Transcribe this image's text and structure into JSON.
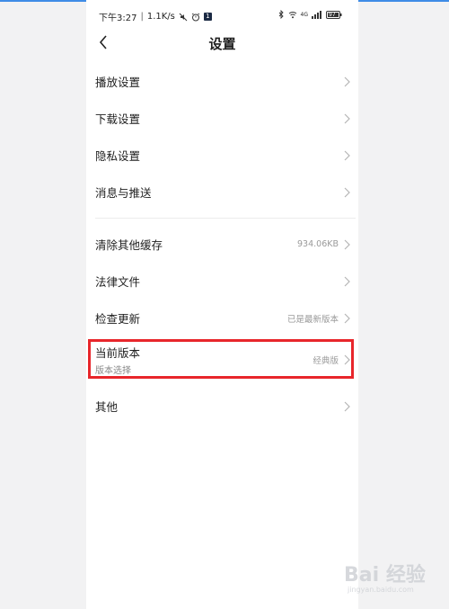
{
  "status_bar": {
    "time": "下午3:27",
    "speed": "1.1K/s",
    "network": "4G",
    "battery": "97"
  },
  "nav": {
    "title": "设置"
  },
  "group1": [
    {
      "label": "播放设置"
    },
    {
      "label": "下载设置"
    },
    {
      "label": "隐私设置"
    },
    {
      "label": "消息与推送"
    }
  ],
  "group2": {
    "clear_cache": {
      "label": "清除其他缓存",
      "value": "934.06KB"
    },
    "legal": {
      "label": "法律文件"
    },
    "update": {
      "label": "检查更新",
      "value": "已是最新版本"
    },
    "version": {
      "label": "当前版本",
      "sub": "版本选择",
      "value": "经典版"
    },
    "other": {
      "label": "其他"
    }
  },
  "colors": {
    "highlight": "#e8262b",
    "chevron": "#b5b5b5"
  },
  "watermark": {
    "brand": "Bai 经验",
    "url": "jingyan.baidu.com"
  }
}
